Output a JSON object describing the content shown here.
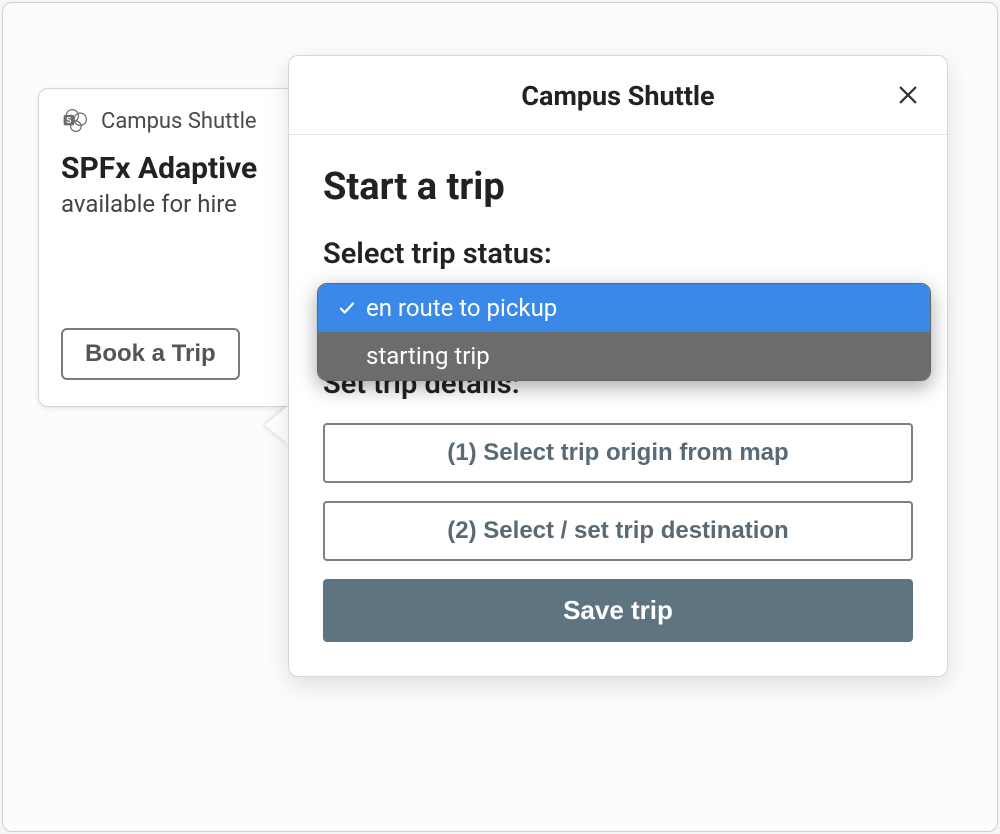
{
  "card": {
    "app_name": "Campus Shuttle",
    "title": "SPFx Adaptive",
    "subtitle": "available for hire",
    "book_label": "Book a Trip"
  },
  "modal": {
    "title": "Campus Shuttle",
    "heading": "Start a trip",
    "select_label": "Select trip status:",
    "details_label": "Set trip details:",
    "dropdown": {
      "options": [
        "en route to pickup",
        "starting trip"
      ],
      "selected_index": 0,
      "option0": "en route to pickup",
      "option1": "starting trip"
    },
    "origin_button": "(1) Select trip origin from map",
    "destination_button": "(2) Select / set trip destination",
    "save_button": "Save trip"
  },
  "icons": {
    "close": "close-icon",
    "check": "check-icon",
    "app": "sharepoint-icon"
  }
}
